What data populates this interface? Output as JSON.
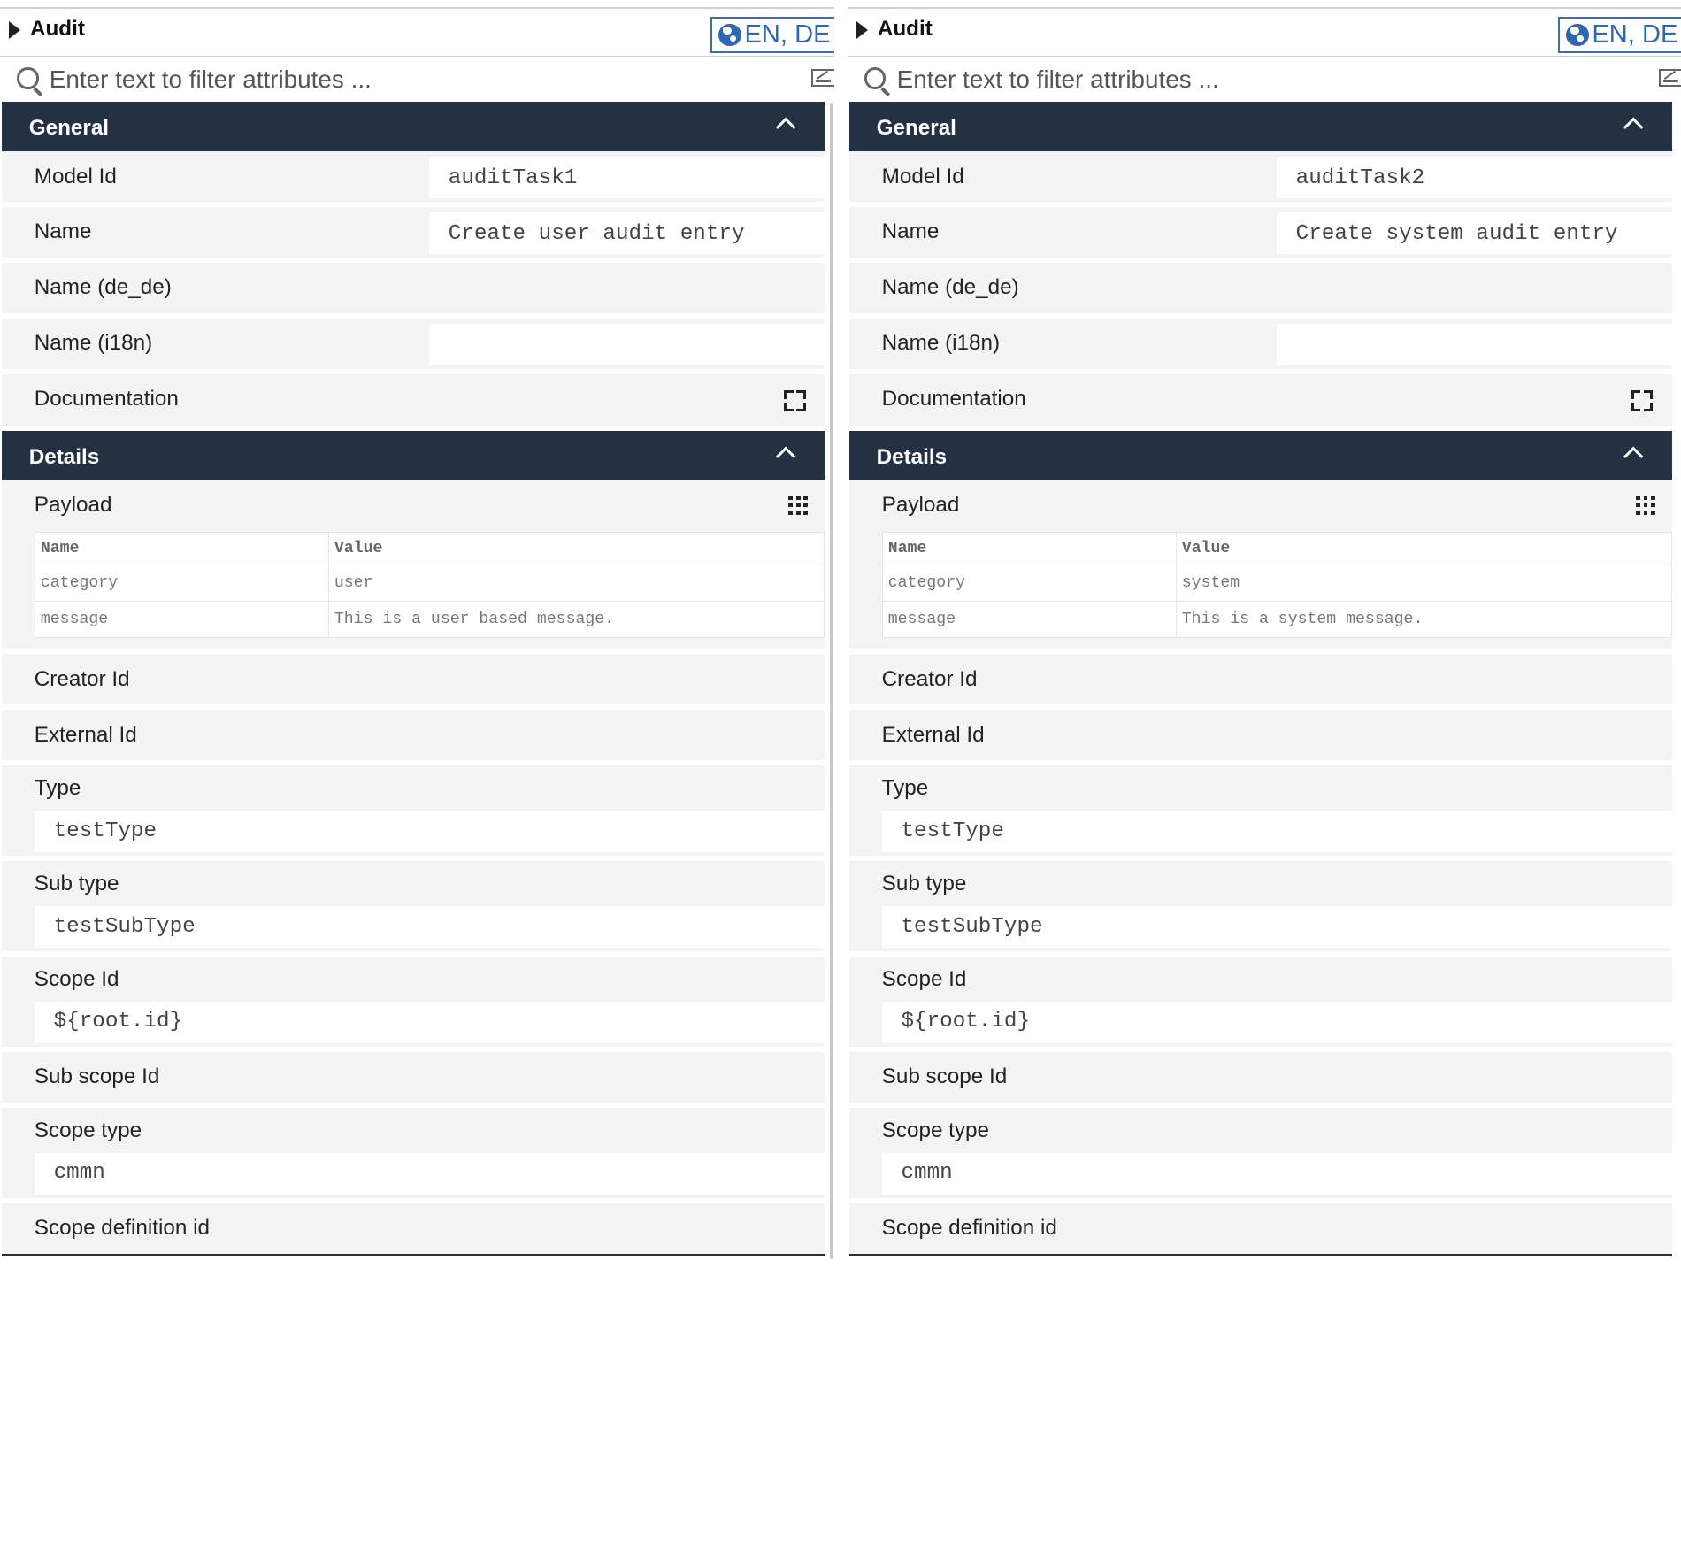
{
  "panels": [
    {
      "title": "Audit",
      "language": "EN, DE",
      "filter_placeholder": "Enter text to filter attributes ...",
      "general": {
        "header": "General",
        "model_id_label": "Model Id",
        "model_id": "auditTask1",
        "name_label": "Name",
        "name": "Create user audit entry",
        "name_de_label": "Name (de_de)",
        "name_i18n_label": "Name (i18n)",
        "name_i18n": "",
        "documentation_label": "Documentation"
      },
      "details": {
        "header": "Details",
        "payload_label": "Payload",
        "payload_columns": [
          "Name",
          "Value"
        ],
        "payload_rows": [
          [
            "category",
            "user"
          ],
          [
            "message",
            "This is a user based message."
          ]
        ],
        "creator_id_label": "Creator Id",
        "external_id_label": "External Id",
        "type_label": "Type",
        "type": "testType",
        "sub_type_label": "Sub type",
        "sub_type": "testSubType",
        "scope_id_label": "Scope Id",
        "scope_id": "${root.id}",
        "sub_scope_id_label": "Sub scope Id",
        "scope_type_label": "Scope type",
        "scope_type": "cmmn",
        "scope_definition_id_label": "Scope definition id"
      }
    },
    {
      "title": "Audit",
      "language": "EN, DE",
      "filter_placeholder": "Enter text to filter attributes ...",
      "general": {
        "header": "General",
        "model_id_label": "Model Id",
        "model_id": "auditTask2",
        "name_label": "Name",
        "name": "Create system audit entry",
        "name_de_label": "Name (de_de)",
        "name_i18n_label": "Name (i18n)",
        "name_i18n": "",
        "documentation_label": "Documentation"
      },
      "details": {
        "header": "Details",
        "payload_label": "Payload",
        "payload_columns": [
          "Name",
          "Value"
        ],
        "payload_rows": [
          [
            "category",
            "system"
          ],
          [
            "message",
            "This is a system message."
          ]
        ],
        "creator_id_label": "Creator Id",
        "external_id_label": "External Id",
        "type_label": "Type",
        "type": "testType",
        "sub_type_label": "Sub type",
        "sub_type": "testSubType",
        "scope_id_label": "Scope Id",
        "scope_id": "${root.id}",
        "sub_scope_id_label": "Sub scope Id",
        "scope_type_label": "Scope type",
        "scope_type": "cmmn",
        "scope_definition_id_label": "Scope definition id"
      }
    }
  ],
  "colors": {
    "group_header_bg": "#243142",
    "accent_blue": "#2f67b0",
    "row_bg": "#f4f4f4"
  },
  "icons": [
    "caret-right-icon",
    "globe-icon",
    "search-icon",
    "clear-filter-icon",
    "chevron-up-icon",
    "expand-icon",
    "grid-icon"
  ]
}
